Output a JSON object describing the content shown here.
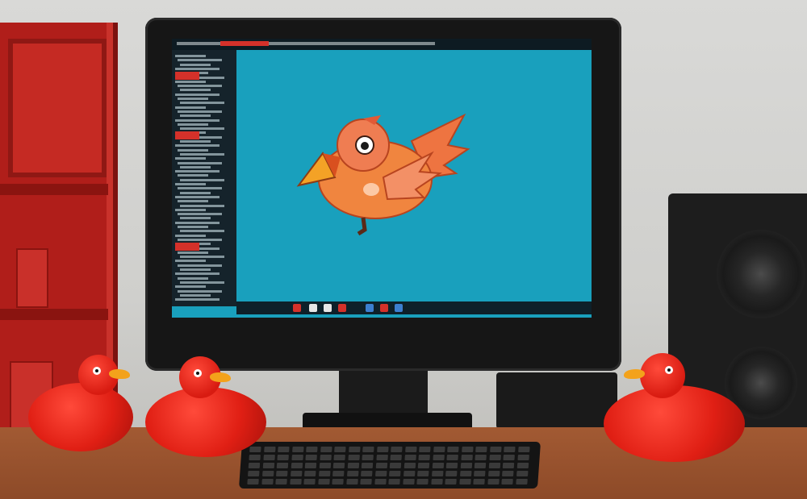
{
  "scene": {
    "description_type": "photo-like illustration",
    "colors": {
      "wall": "#d3d3d0",
      "shelf": "#b01e1a",
      "screen": "#19a0bd",
      "desk": "#9a532e",
      "duck": "#e01f14",
      "bird": "#f07a3e"
    }
  },
  "icons": {
    "bird": "bird-icon"
  }
}
